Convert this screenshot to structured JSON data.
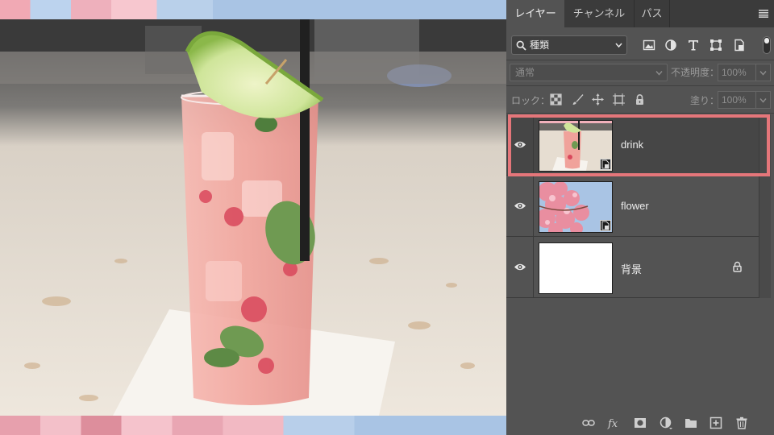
{
  "panel": {
    "tabs": [
      {
        "label": "レイヤー",
        "active": true
      },
      {
        "label": "チャンネル",
        "active": false
      },
      {
        "label": "パス",
        "active": false
      }
    ],
    "filter": {
      "kind_label": "種類",
      "icons": [
        "image-filter-icon",
        "adjustment-filter-icon",
        "type-filter-icon",
        "shape-filter-icon",
        "smart-object-filter-icon"
      ]
    },
    "blend_mode": "通常",
    "opacity_label": "不透明度：",
    "opacity_value": "100%",
    "lock_label": "ロック：",
    "fill_label": "塗り：",
    "fill_value": "100%",
    "layers": [
      {
        "name": "drink",
        "visible": true,
        "selected": true,
        "smart_object": true
      },
      {
        "name": "flower",
        "visible": true,
        "selected": false,
        "smart_object": true
      },
      {
        "name": "背景",
        "visible": true,
        "selected": false,
        "locked": true
      }
    ],
    "bottom_icons": [
      "link-layers-icon",
      "fx-icon",
      "layer-mask-icon",
      "adjustment-layer-icon",
      "group-folder-icon",
      "new-layer-icon",
      "trash-icon"
    ]
  },
  "colors": {
    "highlight": "#e5767a",
    "panel_bg": "#535353",
    "tab_bar_bg": "#3b3b3b"
  }
}
